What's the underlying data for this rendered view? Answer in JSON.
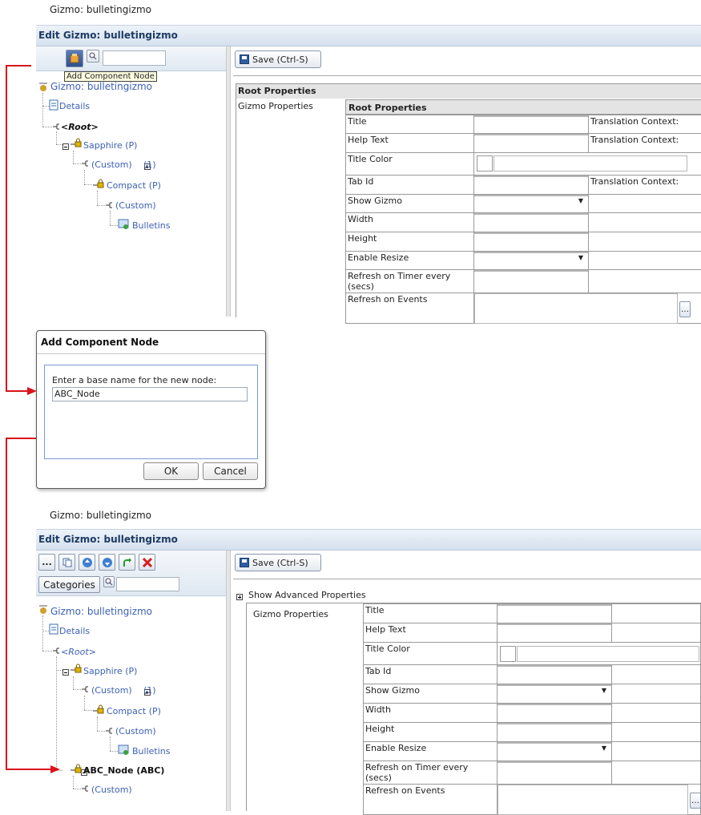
{
  "page_title": "Gizmo: bulletingizmo",
  "header_title": "Edit Gizmo: bulletingizmo",
  "save_label": "Save (Ctrl-S)",
  "tooltip": "Add Component Node",
  "categories_label": "Categories",
  "more_label": "...",
  "tree_top": {
    "root": "Gizmo: bulletingizmo",
    "details": "Details",
    "root_node": "<Root>",
    "sapphire": "Sapphire (P)",
    "custom1": "(Custom)",
    "count1": "(1)",
    "compact": "Compact (P)",
    "custom2": "(Custom)",
    "bulletins": "Bulletins"
  },
  "tree_bottom": {
    "root": "Gizmo: bulletingizmo",
    "details": "Details",
    "root_node": "<Root>",
    "sapphire": "Sapphire (P)",
    "custom1": "(Custom)",
    "count1": "(1)",
    "compact": "Compact (P)",
    "custom2": "(Custom)",
    "bulletins": "Bulletins",
    "abc": "ABC_Node (ABC)",
    "custom3": "(Custom)"
  },
  "props_top": {
    "root_header": "Root Properties",
    "group": "Gizmo Properties",
    "inner_header": "Root Properties",
    "rows": [
      "Title",
      "Help Text",
      "Title Color",
      "Tab Id",
      "Show Gizmo",
      "Width",
      "Height",
      "Enable Resize",
      "Refresh on Timer every (secs)",
      "Refresh on Events"
    ],
    "translation_context": "Translation Context:"
  },
  "props_bottom": {
    "show_advanced": "Show Advanced Properties",
    "group": "Gizmo Properties",
    "rows": [
      "Title",
      "Help Text",
      "Title Color",
      "Tab Id",
      "Show Gizmo",
      "Width",
      "Height",
      "Enable Resize",
      "Refresh on Timer every (secs)",
      "Refresh on Events"
    ]
  },
  "dialog": {
    "title": "Add Component Node",
    "prompt": "Enter a base name for the new node:",
    "value": "ABC_Node",
    "ok": "OK",
    "cancel": "Cancel"
  },
  "colors": {
    "arrow": "#d9141b",
    "link": "#3d60b5",
    "header_text": "#1d3a63"
  }
}
